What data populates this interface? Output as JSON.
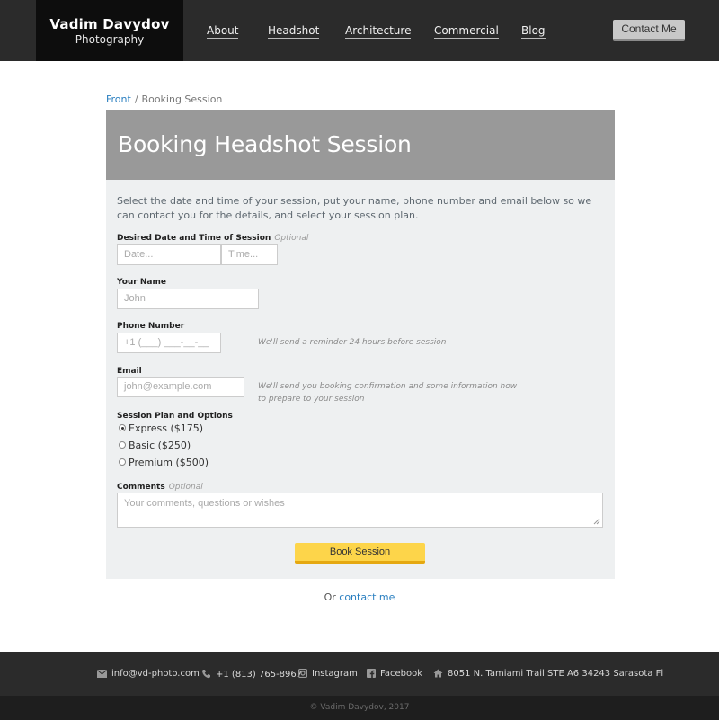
{
  "header": {
    "brand_name": "Vadim Davydov",
    "brand_sub": "Photography",
    "nav": [
      "About",
      "Headshot",
      "Architecture",
      "Commercial",
      "Blog"
    ],
    "contact_button": "Contact Me"
  },
  "breadcrumb": {
    "home": "Front",
    "separator": "/",
    "current": "Booking Session"
  },
  "form": {
    "title": "Booking Headshot Session",
    "intro": "Select the date and time of your session, put your name, phone number and email below so we can contact you for the details, and select your session plan.",
    "datetime": {
      "label": "Desired Date and Time of Session",
      "optional": "Optional",
      "date_placeholder": "Date...",
      "time_placeholder": "Time..."
    },
    "name": {
      "label": "Your Name",
      "placeholder": "John"
    },
    "phone": {
      "label": "Phone Number",
      "placeholder": "+1 (___) ___-__-__",
      "hint": "We'll send a reminder 24 hours before session"
    },
    "email": {
      "label": "Email",
      "placeholder": "john@example.com",
      "hint": "We'll send you booking confirmation and some information how to prepare to your session"
    },
    "plan": {
      "label": "Session Plan and Options",
      "options": [
        "Express ($175)",
        "Basic ($250)",
        "Premium ($500)"
      ],
      "selected": "Express ($175)"
    },
    "comments": {
      "label": "Comments",
      "optional": "Optional",
      "placeholder": "Your comments, questions or wishes"
    },
    "submit": "Book Session"
  },
  "alt_contact": {
    "prefix": "Or",
    "link": "contact me"
  },
  "footer": {
    "email": "info@vd-photo.com",
    "phone": "+1 (813) 765-8967",
    "instagram": "Instagram",
    "facebook": "Facebook",
    "address": "8051 N. Tamiami Trail STE A6 34243 Sarasota Fl",
    "copyright": "© Vadim Davydov, 2017"
  },
  "colors": {
    "header_bg": "#2b2b2b",
    "brand_bg": "#0d0d0d",
    "card_head": "#999999",
    "card_body": "#eef0f1",
    "accent_button": "#fdd54a",
    "link": "#2a7fc0"
  },
  "icons": {
    "email": "envelope-icon",
    "phone": "phone-icon",
    "instagram": "instagram-icon",
    "facebook": "facebook-icon",
    "address": "home-icon"
  }
}
